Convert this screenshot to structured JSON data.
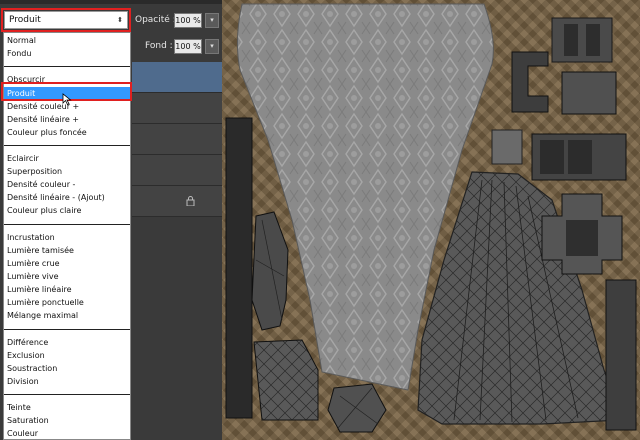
{
  "layers_panel": {
    "blend_mode": {
      "selected": "Produit",
      "options_groups": [
        [
          "Normal",
          "Fondu"
        ],
        [
          "Obscurcir",
          "Produit",
          "Densité couleur +",
          "Densité linéaire +",
          "Couleur plus foncée"
        ],
        [
          "Eclaircir",
          "Superposition",
          "Densité couleur -",
          "Densité linéaire - (Ajout)",
          "Couleur plus claire"
        ],
        [
          "Incrustation",
          "Lumière tamisée",
          "Lumière crue",
          "Lumière vive",
          "Lumière linéaire",
          "Lumière ponctuelle",
          "Mélange maximal"
        ],
        [
          "Différence",
          "Exclusion",
          "Soustraction",
          "Division"
        ],
        [
          "Teinte",
          "Saturation",
          "Couleur"
        ]
      ]
    },
    "opacity": {
      "label": "Opacité :",
      "value": "100 %"
    },
    "fill": {
      "label": "Fond :",
      "value": "100 %"
    },
    "icons": {
      "lock": "lock-icon",
      "dropdown": "chevron-down-icon",
      "cursor": "arrow-cursor-icon"
    }
  },
  "colors": {
    "highlight_border": "#e02020",
    "selection_blue": "#3399ff",
    "panel_bg": "#3a3a3a"
  }
}
